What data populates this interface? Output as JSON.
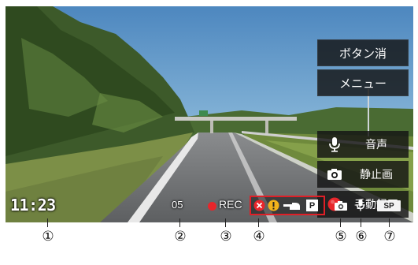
{
  "menu": {
    "hide_buttons_label": "ボタン消",
    "menu_label": "メニュー"
  },
  "actions": {
    "audio_label": "音声",
    "still_label": "静止画",
    "manual_rec_label": "手動録画"
  },
  "status_bar": {
    "time": "11:23",
    "count": "05",
    "rec_label": "REC",
    "parking_badge": "P",
    "speed_badge": "SP"
  },
  "callouts": [
    "①",
    "②",
    "③",
    "④",
    "⑤",
    "⑥",
    "⑦"
  ],
  "colors": {
    "record_red": "#e8262b",
    "status_border": "#e01f27",
    "warning_yellow": "#f2b21b",
    "overlay_dark": "#141414"
  },
  "icons": [
    "microphone-icon",
    "camera-icon",
    "record-dot-icon",
    "error-x-icon",
    "warning-icon",
    "hand-pointer-icon",
    "parking-icon"
  ]
}
